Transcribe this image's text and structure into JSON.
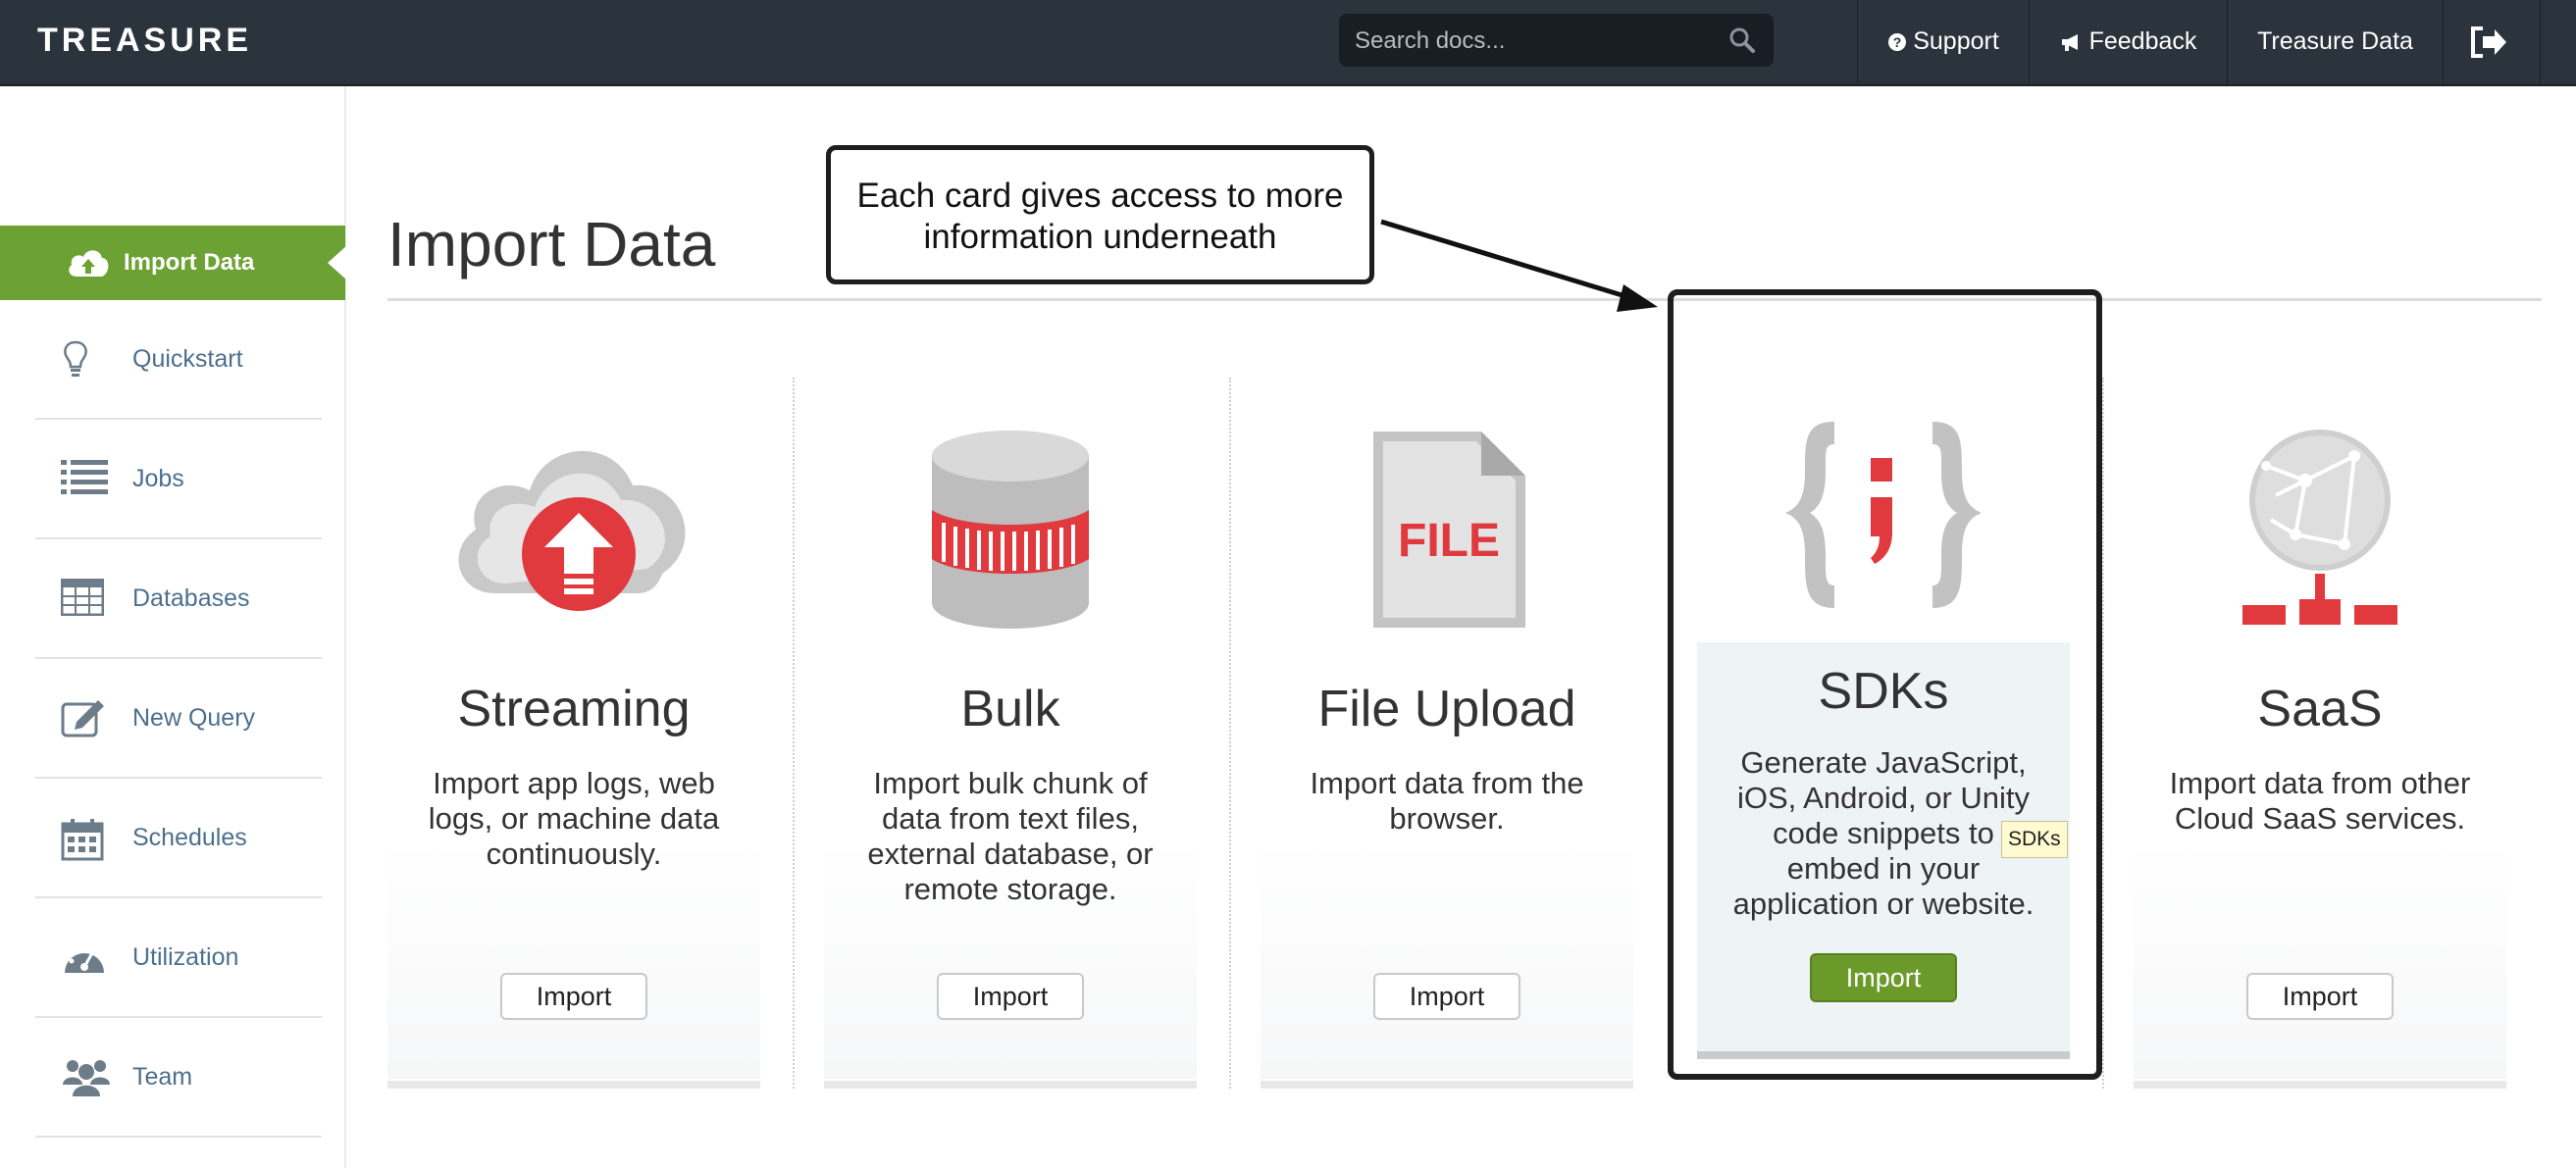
{
  "header": {
    "logo": "TREASURE",
    "search_placeholder": "Search docs...",
    "nav": {
      "support": "Support",
      "feedback": "Feedback",
      "treasure_data": "Treasure Data"
    }
  },
  "sidebar": {
    "items": [
      {
        "label": "Import Data",
        "icon": "cloud-upload-icon",
        "active": true
      },
      {
        "label": "Quickstart",
        "icon": "lightbulb-icon"
      },
      {
        "label": "Jobs",
        "icon": "list-icon"
      },
      {
        "label": "Databases",
        "icon": "table-icon"
      },
      {
        "label": "New Query",
        "icon": "edit-icon"
      },
      {
        "label": "Schedules",
        "icon": "calendar-icon"
      },
      {
        "label": "Utilization",
        "icon": "dashboard-icon"
      },
      {
        "label": "Team",
        "icon": "users-icon"
      }
    ]
  },
  "main": {
    "title": "Import Data",
    "cards": [
      {
        "name": "Streaming",
        "description": "Import app logs, web logs, or machine data continuously.",
        "button": "Import"
      },
      {
        "name": "Bulk",
        "description": "Import bulk chunk of data from text files, external database, or remote storage.",
        "button": "Import"
      },
      {
        "name": "File Upload",
        "description": "Import data from the browser.",
        "button": "Import",
        "icon_text": "FILE"
      },
      {
        "name": "SDKs",
        "description": "Generate JavaScript, iOS, Android, or Unity code snippets to embed in your application or website.",
        "button": "Import",
        "highlighted": true,
        "tooltip": "SDKs"
      },
      {
        "name": "SaaS",
        "description": "Import data from other Cloud SaaS services.",
        "button": "Import"
      }
    ]
  },
  "annotation": {
    "callout_text": "Each card gives access to more information underneath"
  },
  "colors": {
    "topbar": "#2b333c",
    "accent_green": "#6ca133",
    "icon_red": "#e0393e",
    "sidebar_text": "#4c6f8d"
  }
}
